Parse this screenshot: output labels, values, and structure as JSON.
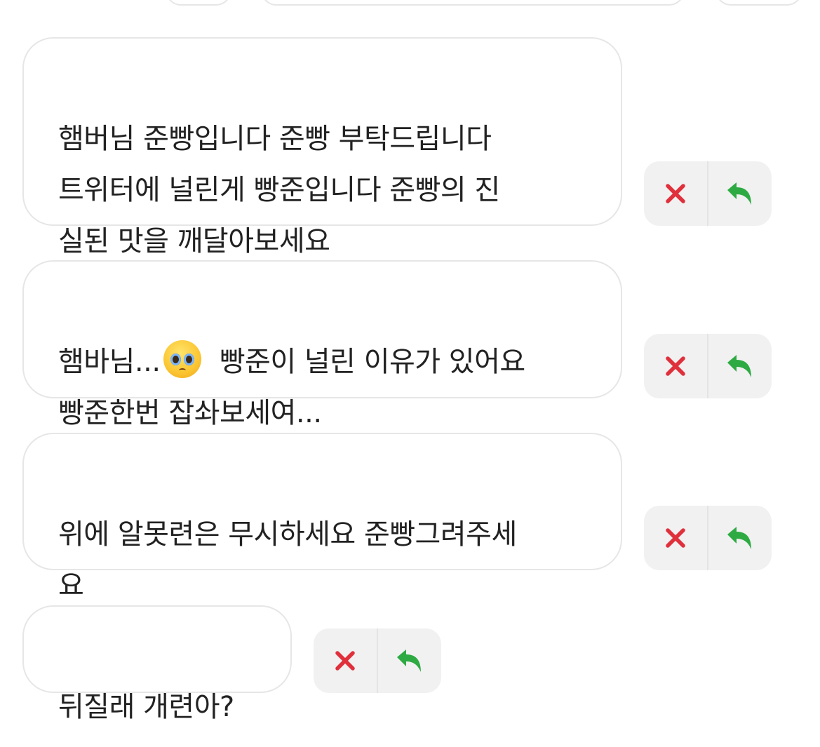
{
  "messages": [
    {
      "text": "햄버님 준빵입니다 준빵 부탁드립니다\n트위터에 널린게 빵준입니다 준빵의 진\n실된 맛을 깨달아보세요"
    },
    {
      "text_before": "햄바님...",
      "emoji": "pleading-face",
      "text_after": " 빵준이 널린 이유가 있어요\n빵준한번 잡솨보세여..."
    },
    {
      "text": "위에 알못련은 무시하세요 준빵그려주세\n요"
    },
    {
      "text": "뒤질래 개련아?"
    }
  ],
  "actions": {
    "delete_icon": "close-icon",
    "reply_icon": "reply-icon",
    "colors": {
      "delete": "#e0303c",
      "reply": "#2eaa43",
      "button_bg": "#f1f1f1",
      "bubble_border": "#e6e6e6"
    }
  }
}
